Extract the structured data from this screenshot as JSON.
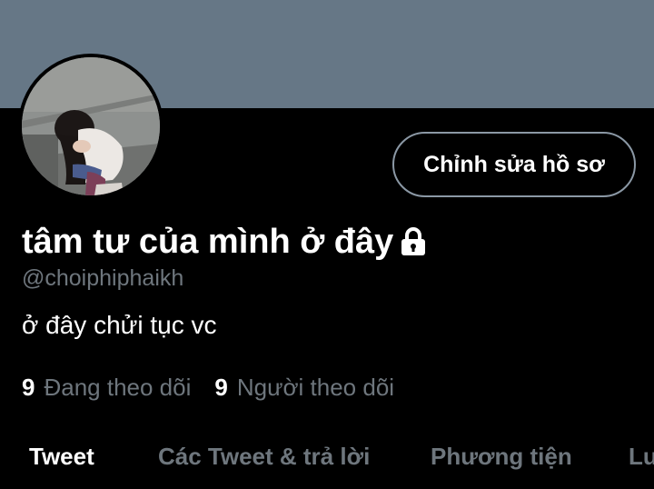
{
  "profile": {
    "edit_button_label": "Chỉnh sửa hồ sơ",
    "display_name": "tâm tư của mình ở đây",
    "handle": "@choiphiphaikh",
    "bio": "ở đây chửi tục vc",
    "following_count": "9",
    "following_label": "Đang theo dõi",
    "followers_count": "9",
    "followers_label": "Người theo dõi"
  },
  "tabs": [
    {
      "label": "Tweet",
      "active": true
    },
    {
      "label": "Các Tweet & trả lời",
      "active": false
    },
    {
      "label": "Phương tiện",
      "active": false
    },
    {
      "label": "Lu",
      "active": false
    }
  ],
  "colors": {
    "background": "#000000",
    "banner": "#667786",
    "secondary_text": "#6e767d",
    "button_border": "#8b98a5"
  },
  "icons": {
    "protected_account": "lock-icon"
  }
}
